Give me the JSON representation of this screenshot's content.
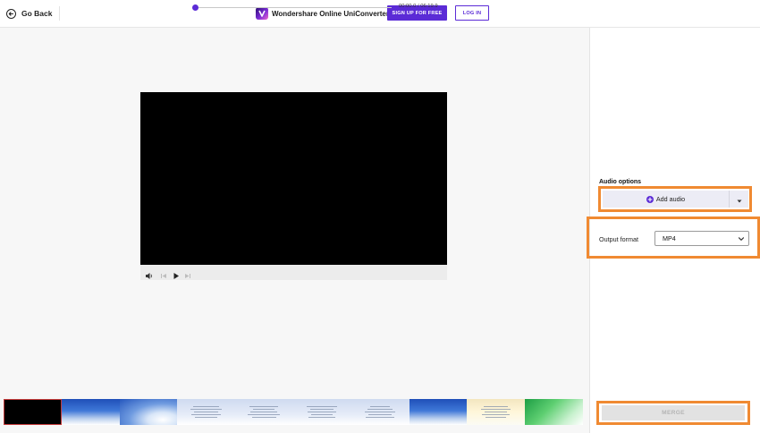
{
  "header": {
    "back_label": "Go Back",
    "brand_name": "Wondershare Online UniConverter",
    "signup_label": "SIGN UP FOR FREE",
    "login_label": "LOG IN"
  },
  "player": {
    "current_time": "00:00.0",
    "separator": "/",
    "duration": "06:19.9",
    "progress_fraction": 0.0
  },
  "filmstrip": {
    "frames": [
      "black",
      "sky",
      "sky2",
      "text",
      "text",
      "text",
      "text",
      "sky",
      "warm",
      "green"
    ]
  },
  "audio": {
    "title": "Audio options",
    "add_label": "Add audio"
  },
  "output": {
    "label": "Output format",
    "selected": "MP4"
  },
  "merge_label": "MERGE",
  "colors": {
    "accent": "#5b2bd6",
    "highlight": "#f08a32"
  },
  "icons": {
    "back": "arrow-left-circle-icon",
    "volume": "speaker-icon",
    "prev": "skip-back-icon",
    "play": "play-icon",
    "next": "skip-forward-icon",
    "add": "plus-circle-icon",
    "caret": "caret-down-icon",
    "chevron": "chevron-down-icon"
  }
}
